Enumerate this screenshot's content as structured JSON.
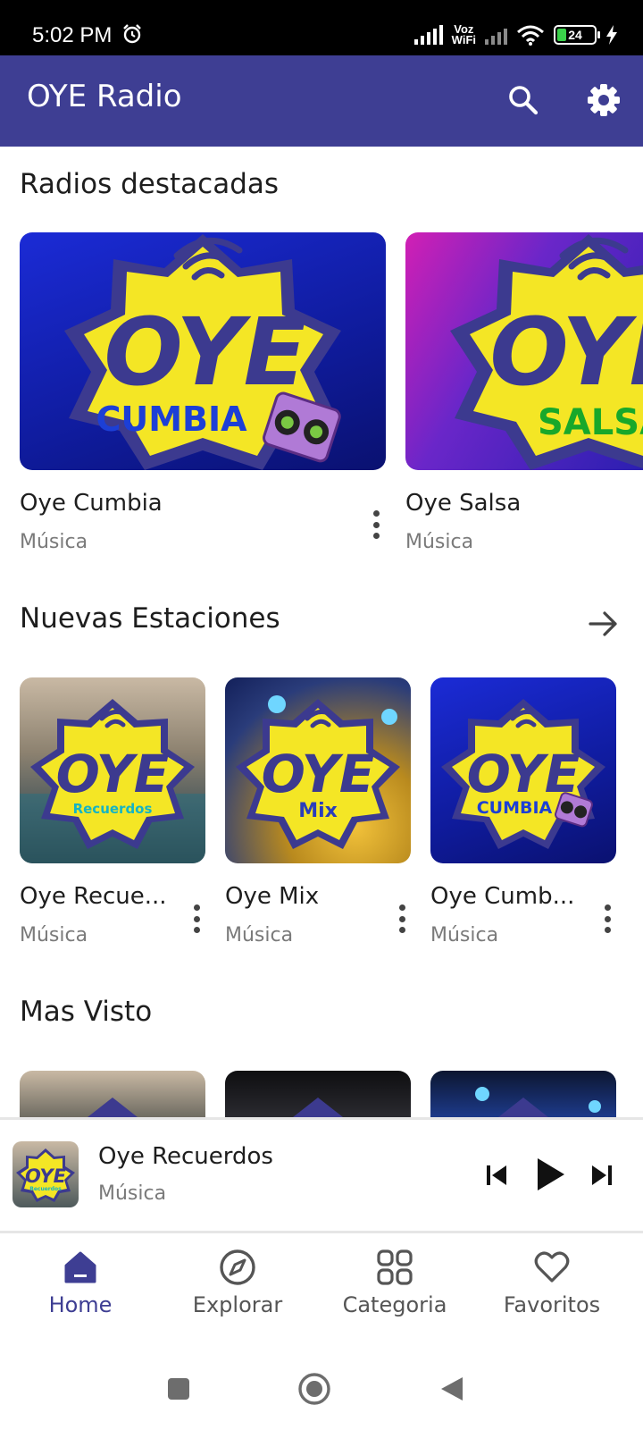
{
  "status_bar": {
    "time": "5:02 PM",
    "battery_level": "24",
    "network_label": "Voz WiFi"
  },
  "app_bar": {
    "title": "OYE Radio",
    "search_icon": "search-icon",
    "settings_icon": "gear-icon",
    "color": "#3e3e93"
  },
  "featured": {
    "title": "Radios destacadas",
    "items": [
      {
        "name": "Oye Cumbia",
        "category": "Música",
        "logo_word": "CUMBIA",
        "logo_word_color": "#1c3fd6"
      },
      {
        "name": "Oye Salsa",
        "category": "Música",
        "logo_word": "SALSA",
        "logo_word_color": "#18a82a"
      }
    ]
  },
  "new_stations": {
    "title": "Nuevas Estaciones",
    "items": [
      {
        "name": "Oye Recue...",
        "category": "Música",
        "logo_word": "Recuerdos",
        "logo_word_color": "#15b4c4"
      },
      {
        "name": "Oye Mix",
        "category": "Música",
        "logo_word": "Mix",
        "logo_word_color": "#2a3dbb"
      },
      {
        "name": "Oye Cumb...",
        "category": "Música",
        "logo_word": "CUMBIA",
        "logo_word_color": "#1c3fd6"
      }
    ]
  },
  "most_viewed": {
    "title": "Mas Visto"
  },
  "logo": {
    "brand": "OYE",
    "star_color": "#f4e625",
    "ring_color": "#3c3a8f"
  },
  "player": {
    "title": "Oye Recuerdos",
    "subtitle": "Música",
    "logo_word": "Recuerdos"
  },
  "bottom_nav": [
    {
      "label": "Home",
      "icon": "home-icon",
      "active": true
    },
    {
      "label": "Explorar",
      "icon": "compass-icon",
      "active": false
    },
    {
      "label": "Categoria",
      "icon": "grid-icon",
      "active": false
    },
    {
      "label": "Favoritos",
      "icon": "heart-icon",
      "active": false
    }
  ]
}
